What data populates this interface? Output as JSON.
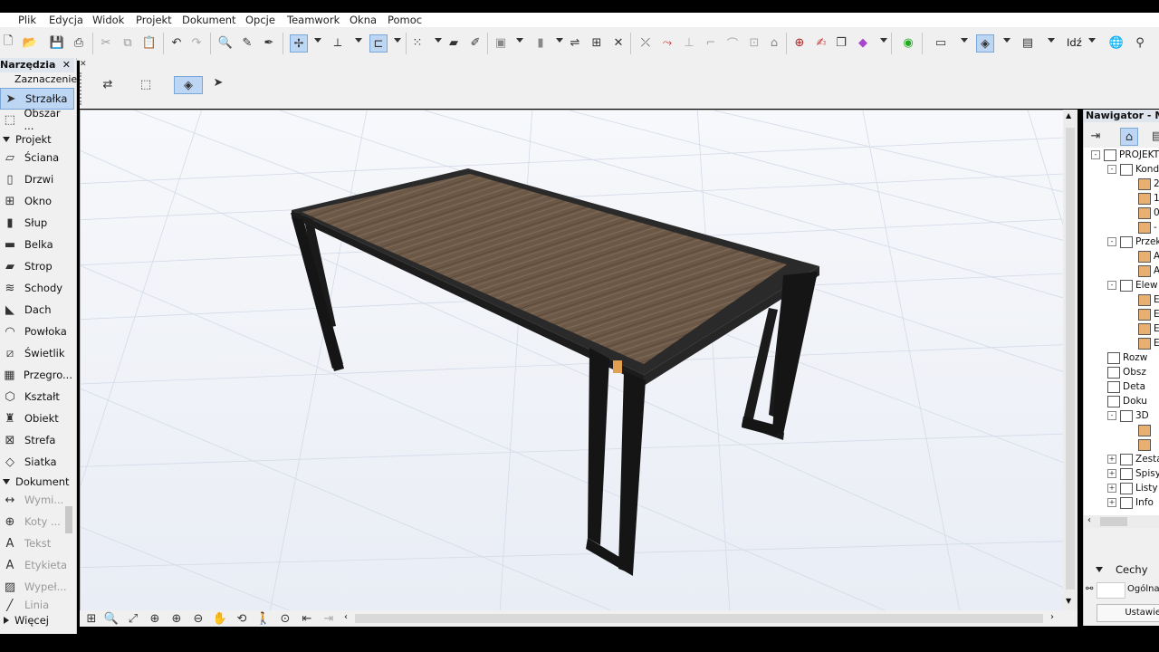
{
  "menu": [
    "Plik",
    "Edycja",
    "Widok",
    "Projekt",
    "Dokument",
    "Opcje",
    "Teamwork",
    "Okna",
    "Pomoc"
  ],
  "toolbar": {
    "goto_label": "Idź"
  },
  "toolbox": {
    "title": "Narzędzia",
    "selection_header": "Zaznaczenie",
    "selection_tools": [
      "Strzałka",
      "Obszar ..."
    ],
    "project_header": "Projekt",
    "project_tools": [
      "Ściana",
      "Drzwi",
      "Okno",
      "Słup",
      "Belka",
      "Strop",
      "Schody",
      "Dach",
      "Powłoka",
      "Świetlik",
      "Przegro...",
      "Kształt",
      "Obiekt",
      "Strefa",
      "Siatka"
    ],
    "document_header": "Dokument",
    "document_tools": [
      "Wymi...",
      "Koty ...",
      "Tekst",
      "Etykieta",
      "Wypeł...",
      "Linia"
    ],
    "more_label": "Więcej"
  },
  "navigator": {
    "title": "Nawigator - Ma",
    "tree": [
      {
        "label": "PROJEKT",
        "depth": 0,
        "pm": "-"
      },
      {
        "label": "Kond",
        "depth": 1,
        "pm": "-"
      },
      {
        "label": "2",
        "depth": 2,
        "pm": ""
      },
      {
        "label": "1",
        "depth": 2,
        "pm": ""
      },
      {
        "label": "0",
        "depth": 2,
        "pm": ""
      },
      {
        "label": "-",
        "depth": 2,
        "pm": ""
      },
      {
        "label": "Przek",
        "depth": 1,
        "pm": "-"
      },
      {
        "label": "A",
        "depth": 2,
        "pm": ""
      },
      {
        "label": "A",
        "depth": 2,
        "pm": ""
      },
      {
        "label": "Elew",
        "depth": 1,
        "pm": "-"
      },
      {
        "label": "E",
        "depth": 2,
        "pm": ""
      },
      {
        "label": "E",
        "depth": 2,
        "pm": ""
      },
      {
        "label": "E",
        "depth": 2,
        "pm": ""
      },
      {
        "label": "E",
        "depth": 2,
        "pm": ""
      },
      {
        "label": "Rozw",
        "depth": 1,
        "pm": ""
      },
      {
        "label": "Obsz",
        "depth": 1,
        "pm": ""
      },
      {
        "label": "Deta",
        "depth": 1,
        "pm": ""
      },
      {
        "label": "Doku",
        "depth": 1,
        "pm": ""
      },
      {
        "label": "3D",
        "depth": 1,
        "pm": "-"
      },
      {
        "label": "",
        "depth": 2,
        "pm": ""
      },
      {
        "label": "",
        "depth": 2,
        "pm": ""
      },
      {
        "label": "Zesta",
        "depth": 1,
        "pm": "+"
      },
      {
        "label": "Spisy",
        "depth": 1,
        "pm": "+"
      },
      {
        "label": "Listy",
        "depth": 1,
        "pm": "+"
      },
      {
        "label": "Info",
        "depth": 1,
        "pm": "+"
      }
    ],
    "properties_header": "Cechy",
    "general_label": "Ogólna",
    "settings_label": "Ustawie"
  },
  "colors": {
    "accent": "#bcd6f4",
    "panel": "#f0f0f0",
    "wood": "#6e5a48",
    "steel": "#1c1c1c"
  }
}
